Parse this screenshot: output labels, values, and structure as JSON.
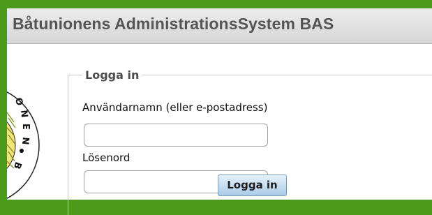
{
  "header": {
    "title": "Båtunionens AdministrationsSystem BAS"
  },
  "logo": {
    "letters": [
      "O",
      "N",
      "E",
      "N",
      "•",
      "B"
    ],
    "text": "...ONEN • B..."
  },
  "login": {
    "legend": "Logga in",
    "username_label": "Användarnamn (eller e-postadress)",
    "username_value": "",
    "password_label": "Lösenord",
    "password_value": "",
    "submit_label": "Logga in"
  },
  "colors": {
    "frame": "#4c9a1c",
    "header": "#e0e0e0",
    "title": "#555555",
    "button": "#b6d4ee"
  }
}
